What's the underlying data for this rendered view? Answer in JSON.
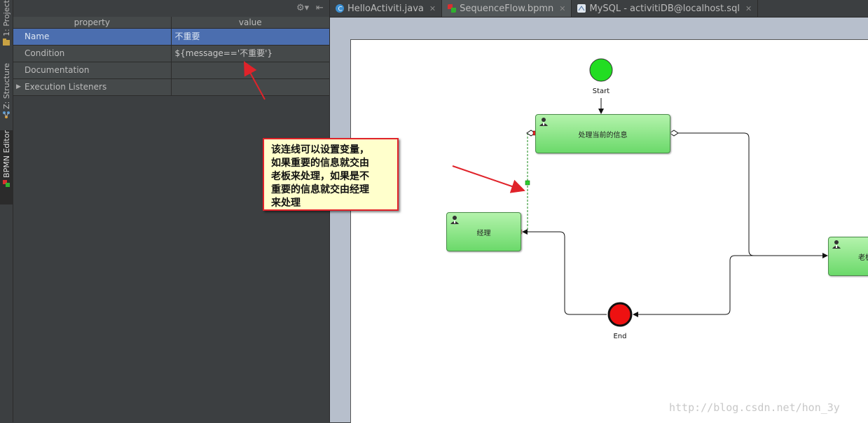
{
  "toolstrip": {
    "project_label": "1: Project",
    "structure_label": "Z: Structure",
    "bpmn_label": "BPMN Editor"
  },
  "properties": {
    "header": {
      "property": "property",
      "value": "value"
    },
    "rows": [
      {
        "name": "Name",
        "value": "不重要"
      },
      {
        "name": "Condition",
        "value": "${message=='不重要'}"
      },
      {
        "name": "Documentation",
        "value": ""
      },
      {
        "name": "Execution Listeners",
        "value": ""
      }
    ]
  },
  "tabs": [
    {
      "label": "HelloActiviti.java",
      "icon": "java-class-icon"
    },
    {
      "label": "SequenceFlow.bpmn",
      "icon": "bpmn-file-icon"
    },
    {
      "label": "MySQL - activitiDB@localhost.sql",
      "icon": "sql-file-icon"
    }
  ],
  "diagram": {
    "start_label": "Start",
    "end_label": "End",
    "task_current": "处理当前的信息",
    "task_manager": "经理",
    "task_boss": "老板"
  },
  "callout": {
    "lines": [
      "该连线可以设置变量，",
      "如果重要的信息就交由",
      "老板来处理，如果是不",
      "重要的信息就交由经理",
      "来处理"
    ]
  },
  "colors": {
    "start_event": "#22dd22",
    "end_event": "#ee1111",
    "task_fill": "#8ae485",
    "selection": "#4b6eaf",
    "annotation_arrow": "#e0232a"
  },
  "watermark": "http://blog.csdn.net/hon_3y"
}
